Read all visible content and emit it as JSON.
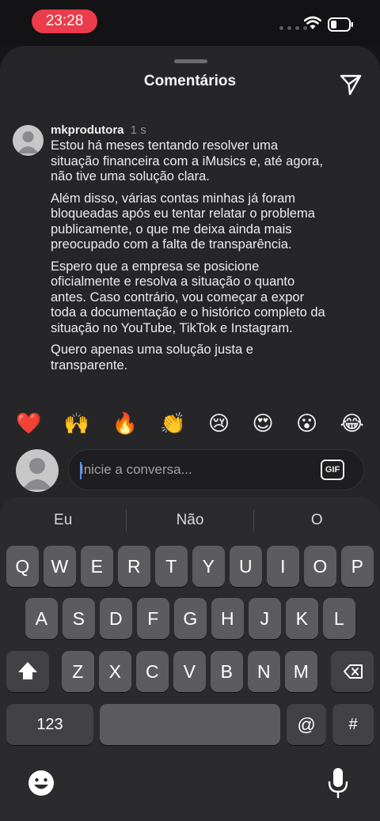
{
  "status_bar": {
    "time": "23:28",
    "icons": [
      "signal-icon",
      "wifi-icon",
      "battery-icon"
    ]
  },
  "sheet": {
    "title": "Comentários",
    "share_icon": "paper-plane-icon"
  },
  "comment": {
    "username": "mkprodutora",
    "time": "1 s",
    "paragraphs": [
      "Estou há meses tentando resolver uma situação financeira com a iMusics e, até agora, não tive uma solução clara.",
      "Além disso, várias contas minhas já foram bloqueadas após eu tentar relatar o problema publicamente, o que me deixa ainda mais preocupado com a falta de transparência.",
      "Espero que a empresa se posicione oficialmente e resolva a situação o quanto antes. Caso contrário, vou começar a expor toda a documentação e o histórico completo da situação no YouTube, TikTok e Instagram.",
      "Quero apenas uma solução justa e transparente."
    ]
  },
  "reactions": [
    "❤️",
    "🙌",
    "🔥",
    "👏",
    "😢",
    "😍",
    "😮",
    "😂"
  ],
  "composer": {
    "placeholder": "Inicie a conversa...",
    "gif_label": "GIF"
  },
  "keyboard": {
    "suggestions": [
      "Eu",
      "Não",
      "O"
    ],
    "row1": [
      "Q",
      "W",
      "E",
      "R",
      "T",
      "Y",
      "U",
      "I",
      "O",
      "P"
    ],
    "row2": [
      "A",
      "S",
      "D",
      "F",
      "G",
      "H",
      "J",
      "K",
      "L"
    ],
    "row3": [
      "Z",
      "X",
      "C",
      "V",
      "B",
      "N",
      "M"
    ],
    "numbers_label": "123",
    "at_label": "@",
    "hash_label": "#"
  }
}
